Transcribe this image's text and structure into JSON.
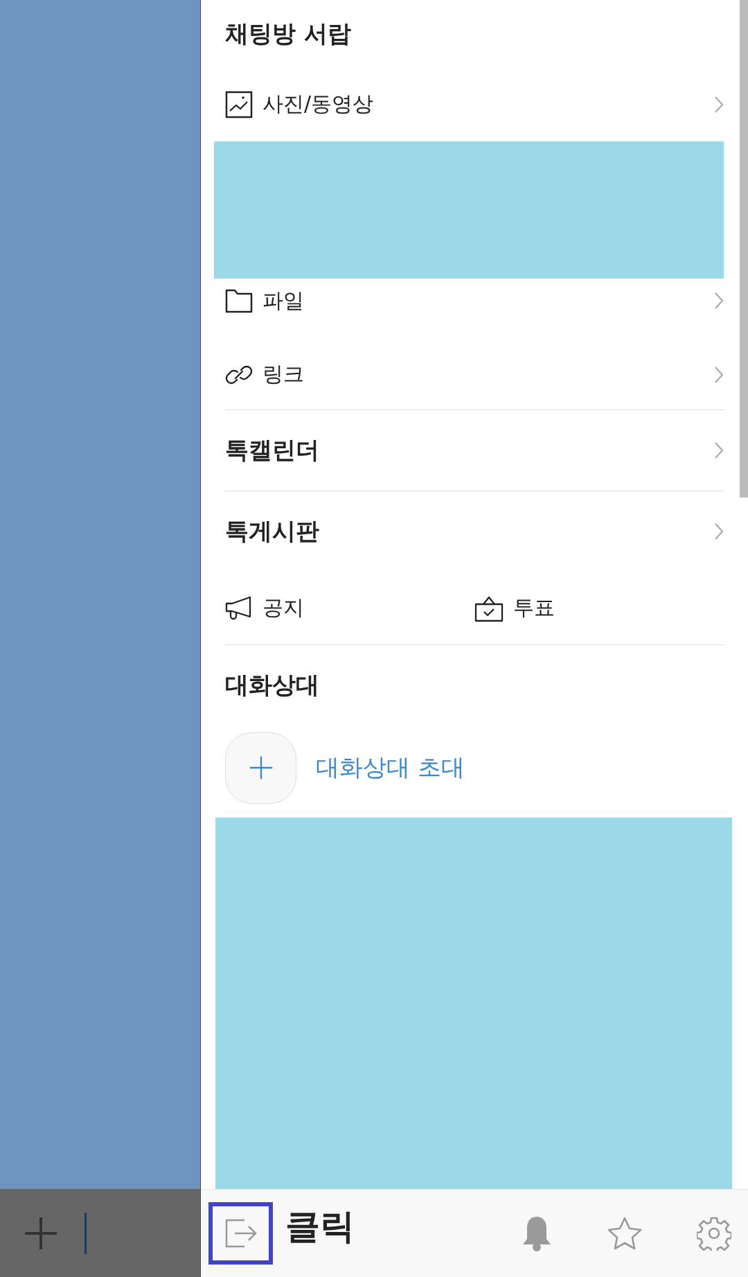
{
  "drawer": {
    "title": "채팅방 서랍",
    "media_items": [
      {
        "kind": "photo",
        "label": "사진/동영상"
      },
      {
        "kind": "file",
        "label": "파일"
      },
      {
        "kind": "link",
        "label": "링크"
      }
    ],
    "sections": [
      {
        "title": "톡캘린더"
      },
      {
        "title": "톡게시판",
        "items": [
          {
            "kind": "notice",
            "label": "공지"
          },
          {
            "kind": "poll",
            "label": "투표"
          }
        ]
      }
    ],
    "members": {
      "title": "대화상대",
      "invite_label": "대화상대 초대"
    }
  },
  "bottom_bar": {
    "label": "클릭"
  }
}
